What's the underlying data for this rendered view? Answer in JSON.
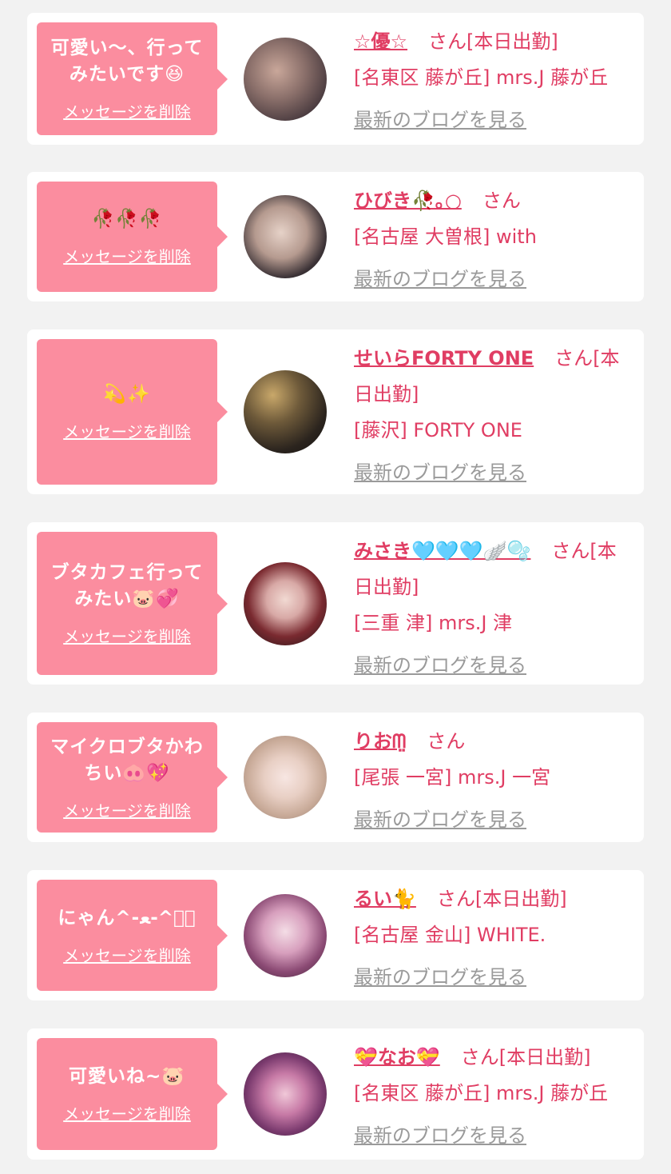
{
  "delete_label": "メッセージを削除",
  "blog_label": "最新のブログを見る",
  "honorific": "さん",
  "colors": {
    "bubble": "#fb8d9f",
    "accent": "#e03d63",
    "blog_link": "#9a9a9a",
    "background": "#f2f2f2"
  },
  "items": [
    {
      "message": "可愛い〜、行って\nみたいです😆",
      "name": "☆優☆",
      "status": "[本日出勤]",
      "shop": "[名東区 藤が丘] mrs.J 藤が丘",
      "avatar_icon": "avatar-photo"
    },
    {
      "message": "🥀🥀🥀",
      "name": "ひびき🥀｡○",
      "status": "",
      "shop": "[名古屋 大曽根] with",
      "avatar_icon": "avatar-photo"
    },
    {
      "message": "💫✨",
      "name": "せいらFORTY ONE",
      "status": "[本日出勤]",
      "shop": "[藤沢] FORTY ONE",
      "avatar_icon": "avatar-photo"
    },
    {
      "message": "ブタカフェ行って\nみたい🐷💞",
      "name": "みさき🩵🩵🩵🪽🫧",
      "status": "[本日出勤]",
      "shop": "[三重 津] mrs.J 津",
      "avatar_icon": "avatar-photo"
    },
    {
      "message": "マイクロブタかわ\nちい🐽💖",
      "name": "りおᗰ̤",
      "status": "",
      "shop": "[尾張 一宮] mrs.J 一宮",
      "avatar_icon": "avatar-photo"
    },
    {
      "message": "にゃん^-ﻌ-^ฅ゙",
      "name": "るい🐈",
      "status": "[本日出勤]",
      "shop": "[名古屋 金山] WHITE.",
      "avatar_icon": "avatar-photo"
    },
    {
      "message": "可愛いね~🐷",
      "name": "💝なお💝",
      "status": "[本日出勤]",
      "shop": "[名東区 藤が丘] mrs.J 藤が丘",
      "avatar_icon": "avatar-photo"
    }
  ]
}
